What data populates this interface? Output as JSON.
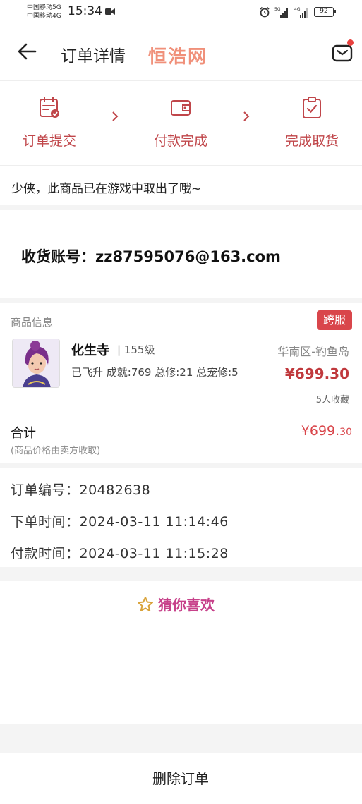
{
  "status_bar": {
    "carrier_1": "中国移动5G",
    "carrier_2": "中国移动4G",
    "time": "15:34",
    "battery": "92"
  },
  "header": {
    "title": "订单详情",
    "watermark": "恒浩网"
  },
  "progress": {
    "steps": [
      {
        "label": "订单提交",
        "icon": "calendar-check-icon"
      },
      {
        "label": "付款完成",
        "icon": "wallet-icon"
      },
      {
        "label": "完成取货",
        "icon": "clipboard-check-icon"
      }
    ],
    "color": "#c0464a"
  },
  "notice": "少侠，此商品已在游戏中取出了哦~",
  "account": {
    "label": "收货账号：zz87595076@163.com"
  },
  "goods": {
    "section_title": "商品信息",
    "badge": "跨服",
    "name": "化生寺",
    "level": "| 155级",
    "server": "华南区-钓鱼岛",
    "stats": "已飞升 成就:769 总修:21 总宠修:5",
    "price": "¥699.30",
    "favorites": "5人收藏",
    "total_label": "合计",
    "total_note": "(商品价格由卖方收取)",
    "total_price_main": "¥699.",
    "total_price_decimal": "30"
  },
  "order_info": {
    "order_no": "订单编号：20482638",
    "order_time": "下单时间：2024-03-11 11:14:46",
    "pay_time": "付款时间：2024-03-11 11:15:28"
  },
  "recommend": {
    "title": "猜你喜欢"
  },
  "footer": {
    "delete_label": "删除订单"
  },
  "colors": {
    "accent": "#d9464b",
    "price": "#c0393d",
    "recommend": "#c7418a"
  }
}
